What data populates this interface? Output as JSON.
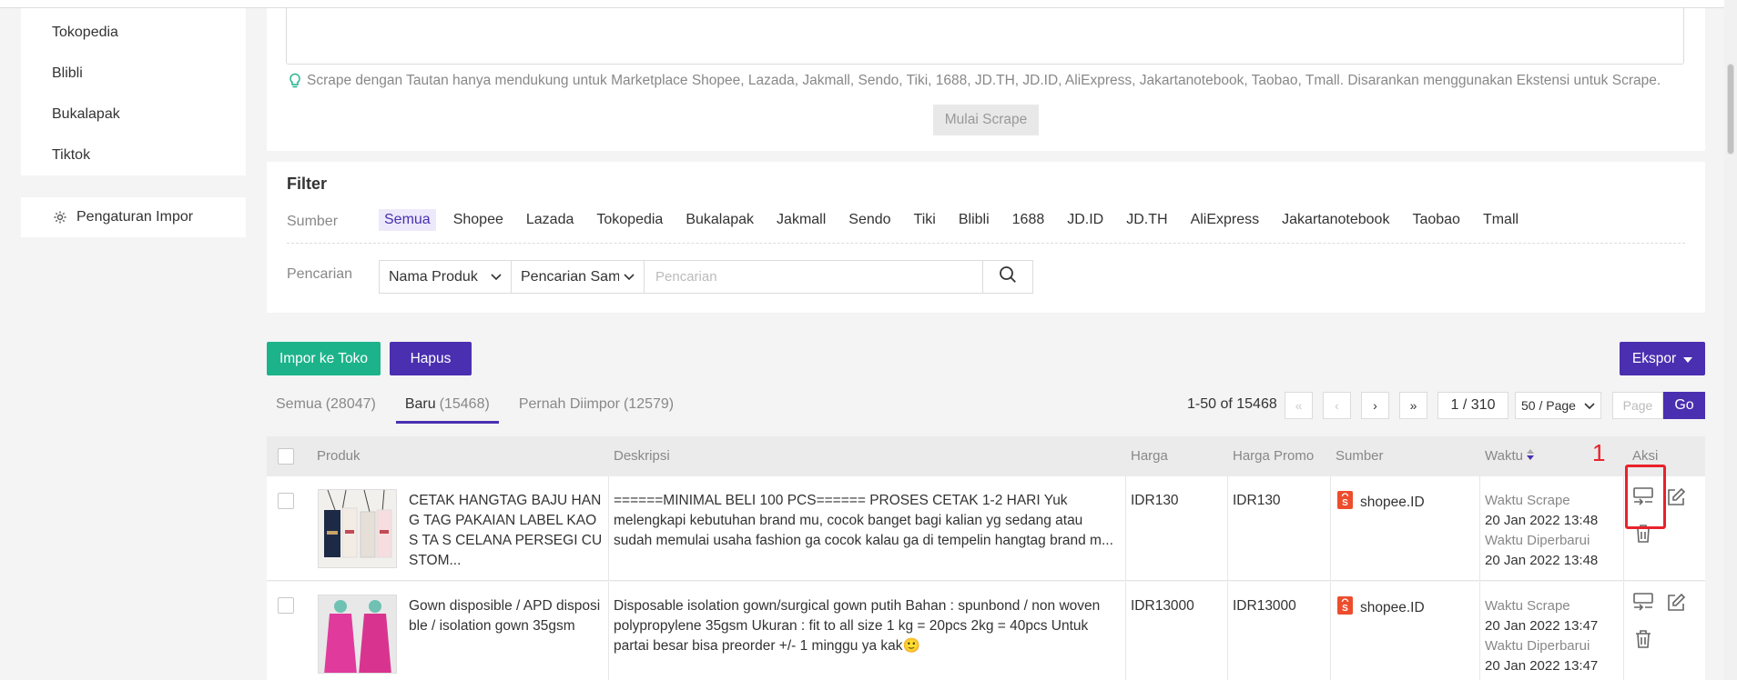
{
  "sidebar": {
    "items": [
      "Tokopedia",
      "Blibli",
      "Bukalapak",
      "Tiktok"
    ],
    "settings_label": "Pengaturan Impor"
  },
  "scrape": {
    "hint": "Scrape dengan Tautan hanya mendukung untuk Marketplace Shopee, Lazada, Jakmall, Sendo, Tiki, 1688, JD.TH, JD.ID, AliExpress, Jakartanotebook, Taobao, Tmall. Disarankan menggunakan Ekstensi untuk Scrape.",
    "button": "Mulai Scrape"
  },
  "filter": {
    "title": "Filter",
    "source_label": "Sumber",
    "sources": [
      "Semua",
      "Shopee",
      "Lazada",
      "Tokopedia",
      "Bukalapak",
      "Jakmall",
      "Sendo",
      "Tiki",
      "Blibli",
      "1688",
      "JD.ID",
      "JD.TH",
      "AliExpress",
      "Jakartanotebook",
      "Taobao",
      "Tmall"
    ],
    "active_source": "Semua",
    "search_label": "Pencarian",
    "field_select": "Nama Produk",
    "match_select": "Pencarian Sam",
    "search_placeholder": "Pencarian"
  },
  "actions": {
    "import": "Impor ke Toko",
    "delete": "Hapus",
    "export": "Ekspor"
  },
  "tabs": [
    {
      "label": "Semua",
      "count": "(28047)"
    },
    {
      "label": "Baru",
      "count": "(15468)"
    },
    {
      "label": "Pernah Diimpor",
      "count": "(12579)"
    }
  ],
  "pagination": {
    "summary": "1-50 of 15468",
    "page": "1 / 310",
    "page_size": "50 / Page",
    "goto_placeholder": "Page",
    "go": "Go"
  },
  "table": {
    "headers": {
      "product": "Produk",
      "description": "Deskripsi",
      "price": "Harga",
      "promo_price": "Harga Promo",
      "source": "Sumber",
      "time": "Waktu",
      "action": "Aksi"
    },
    "rows": [
      {
        "name": "CETAK HANGTAG BAJU HANG TAG PAKAIAN LABEL KAOS TA S CELANA PERSEGI CUSTOM...",
        "description": "======MINIMAL BELI 100 PCS====== PROSES CETAK 1-2 HARI Yuk melengkapi kebutuhan brand mu, cocok banget bagi kalian yg sedang atau sudah memulai usaha fashion ga cocok kalau ga di tempelin hangtag brand m...",
        "price": "IDR130",
        "promo_price": "IDR130",
        "source": "shopee.ID",
        "scrape_label": "Waktu Scrape",
        "scrape_time": "20 Jan 2022 13:48",
        "updated_label": "Waktu Diperbarui",
        "updated_time": "20 Jan 2022 13:48"
      },
      {
        "name": "Gown disposible / APD disposi ble / isolation gown 35gsm",
        "description": "Disposable isolation gown/surgical gown putih Bahan : spunbond / non woven polypropylene 35gsm Ukuran : fit to all size 1 kg = 20pcs 2kg = 40pcs Untuk partai besar bisa preorder +/- 1 minggu ya kak🙂",
        "price": "IDR13000",
        "promo_price": "IDR13000",
        "source": "shopee.ID",
        "scrape_label": "Waktu Scrape",
        "scrape_time": "20 Jan 2022 13:47",
        "updated_label": "Waktu Diperbarui",
        "updated_time": "20 Jan 2022 13:47"
      }
    ]
  },
  "annotation": {
    "number": "1",
    "color": "#e8222a"
  },
  "colors": {
    "accent": "#4a2fb0",
    "green": "#1cb38b",
    "shopee": "#ee4d2d"
  }
}
